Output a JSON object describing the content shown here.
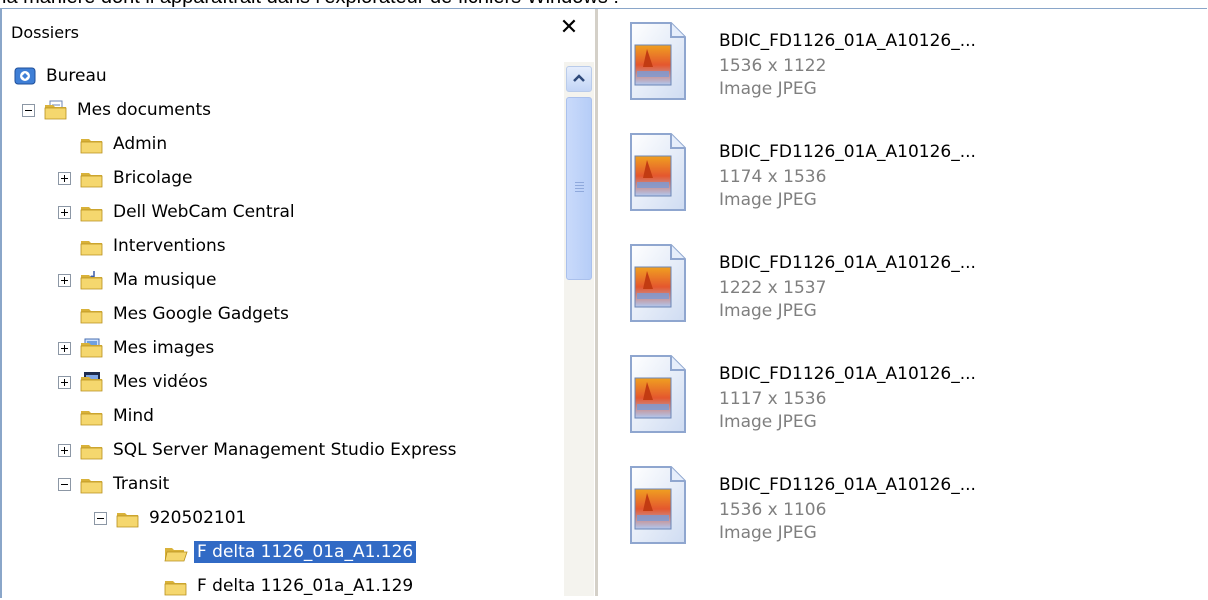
{
  "caption": "la manière dont il apparaîtrait dans l’explorateur de fichiers Windows :",
  "folders_pane": {
    "title": "Dossiers",
    "close_label": "✕"
  },
  "tree": [
    {
      "label": "Bureau",
      "icon": "desktop-icon",
      "expander": "none",
      "indent": 0
    },
    {
      "label": "Mes documents",
      "icon": "documents-folder-icon",
      "expander": "minus",
      "indent": 1
    },
    {
      "label": "Admin",
      "icon": "folder-icon",
      "expander": "none",
      "indent": 2
    },
    {
      "label": "Bricolage",
      "icon": "folder-icon",
      "expander": "plus",
      "indent": 2
    },
    {
      "label": "Dell WebCam Central",
      "icon": "folder-icon",
      "expander": "plus",
      "indent": 2
    },
    {
      "label": "Interventions",
      "icon": "folder-icon",
      "expander": "none",
      "indent": 2
    },
    {
      "label": "Ma musique",
      "icon": "music-folder-icon",
      "expander": "plus",
      "indent": 2
    },
    {
      "label": "Mes Google Gadgets",
      "icon": "folder-icon",
      "expander": "none",
      "indent": 2
    },
    {
      "label": "Mes images",
      "icon": "pictures-folder-icon",
      "expander": "plus",
      "indent": 2
    },
    {
      "label": "Mes vidéos",
      "icon": "videos-folder-icon",
      "expander": "plus",
      "indent": 2
    },
    {
      "label": "Mind",
      "icon": "folder-icon",
      "expander": "none",
      "indent": 2
    },
    {
      "label": "SQL Server Management Studio Express",
      "icon": "folder-icon",
      "expander": "plus",
      "indent": 2
    },
    {
      "label": "Transit",
      "icon": "folder-icon",
      "expander": "minus",
      "indent": 2
    },
    {
      "label": "920502101",
      "icon": "folder-icon",
      "expander": "minus",
      "indent": 3
    },
    {
      "label": "F delta 1126_01a_A1.126",
      "icon": "open-folder-icon",
      "expander": "none",
      "indent": 4,
      "selected": true
    },
    {
      "label": "F delta 1126_01a_A1.129",
      "icon": "folder-icon",
      "expander": "none",
      "indent": 4
    }
  ],
  "files": [
    {
      "name": "BDIC_FD1126_01A_A10126_...",
      "dims": "1536 x 1122",
      "type": "Image JPEG"
    },
    {
      "name": "BDIC_FD1126_01A_A10126_...",
      "dims": "1174 x 1536",
      "type": "Image JPEG"
    },
    {
      "name": "BDIC_FD1126_01A_A10126_...",
      "dims": "1222 x 1537",
      "type": "Image JPEG"
    },
    {
      "name": "BDIC_FD1126_01A_A10126_...",
      "dims": "1117 x 1536",
      "type": "Image JPEG"
    },
    {
      "name": "BDIC_FD1126_01A_A10126_...",
      "dims": "1536 x 1106",
      "type": "Image JPEG"
    }
  ],
  "colors": {
    "selection": "#316ac5",
    "folder": "#f5d76e",
    "secondary_text": "#7f7f7f"
  }
}
